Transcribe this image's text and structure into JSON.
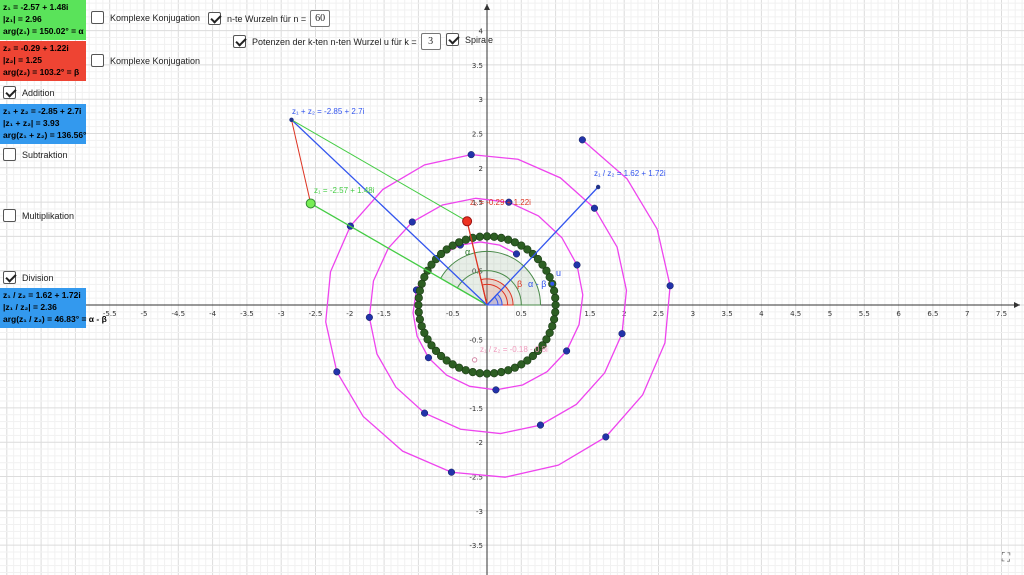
{
  "info": {
    "z1": [
      "z₁ = -2.57 + 1.48i",
      "|z₁| = 2.96",
      "arg(z₁) = 150.02° = α"
    ],
    "z2": [
      "z₂ = -0.29 + 1.22i",
      "|z₂| = 1.25",
      "arg(z₂) = 103.2° = β"
    ],
    "add": [
      "z₁ + z₂ = -2.85 + 2.7i",
      "|z₁ + z₂| = 3.93",
      "arg(z₁ + z₂) = 136.56°"
    ],
    "div": [
      "z₁ / z₂ = 1.62 + 1.72i",
      "|z₁ / z₂| = 2.36",
      "arg(z₁ / z₂) = 46.83° = α - β"
    ]
  },
  "checkboxes": {
    "konj1": {
      "label": "Komplexe Konjugation",
      "checked": false
    },
    "konj2": {
      "label": "Komplexe Konjugation",
      "checked": false
    },
    "wurzeln": {
      "label": "n-te Wurzeln für  n =",
      "checked": true,
      "value": "60"
    },
    "potenzen": {
      "label": "Potenzen der k-ten n-ten Wurzel u für k =",
      "checked": true,
      "value": "3"
    },
    "spirale": {
      "label": "Spirale",
      "checked": true
    },
    "addition": {
      "label": "Addition",
      "checked": true
    },
    "subtraktion": {
      "label": "Subtraktion",
      "checked": false
    },
    "multiplikation": {
      "label": "Multiplikation",
      "checked": false
    },
    "division": {
      "label": "Division",
      "checked": true
    }
  },
  "labels": {
    "z1": "z₁ = -2.57 + 1.48i",
    "z2": "z₂ = -0.29 + 1.22i",
    "sum": "z₁ + z₂ = -2.85 + 2.7i",
    "quot": "z₁ / z₂ = 1.62 + 1.72i",
    "inv": "z₁ / z₂ = -0.18 - 0.8i",
    "alpha": "α",
    "beta": "β",
    "alphaMinusBeta": "α - β",
    "u": "u"
  },
  "axes": {
    "x_ticks": [
      -5.5,
      -5,
      -4.5,
      -4,
      -3.5,
      -3,
      -2.5,
      -2,
      -1.5,
      -1,
      -0.5,
      0.5,
      1,
      1.5,
      2,
      2.5,
      3,
      3.5,
      4,
      4.5,
      5,
      5.5,
      6,
      6.5,
      7,
      7.5
    ],
    "y_ticks": [
      4,
      3.5,
      3,
      2.5,
      2,
      1.5,
      1,
      0.5,
      -0.5,
      -1,
      -1.5,
      -2,
      -2.5,
      -3,
      -3.5
    ]
  },
  "colors": {
    "grid": "#e4e4e4",
    "axis": "#333333",
    "z1": "#44cc44",
    "z2": "#dd3322",
    "sum": "#3355ee",
    "roots": "#2d5e23",
    "spiral": "#ee44ee",
    "spiralPoint": "#2233aa",
    "unitCircle": "#226644"
  },
  "fullscreen": "⛶"
}
